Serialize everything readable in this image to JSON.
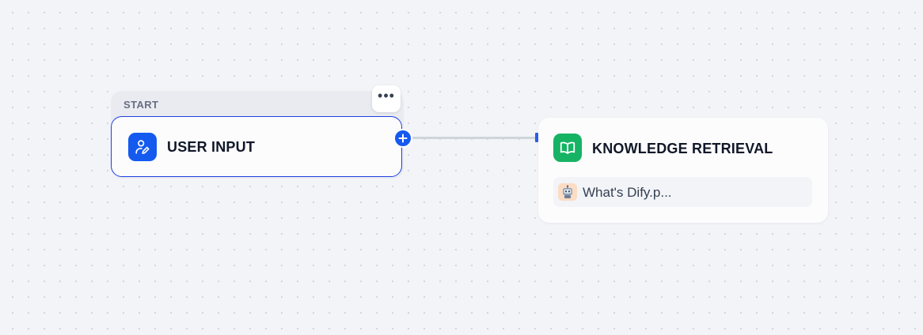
{
  "start_node": {
    "group_label": "START",
    "title": "USER INPUT",
    "more_label": "•••",
    "accent": "#155aef",
    "icon": "user-edit-icon"
  },
  "knowledge_node": {
    "title": "KNOWLEDGE RETRIEVAL",
    "accent": "#16b364",
    "icon": "book-open-icon",
    "datasets": [
      {
        "name": "What's Dify.p...",
        "icon": "robot-icon"
      }
    ]
  },
  "edge": {
    "handle_icon": "plus-icon"
  }
}
